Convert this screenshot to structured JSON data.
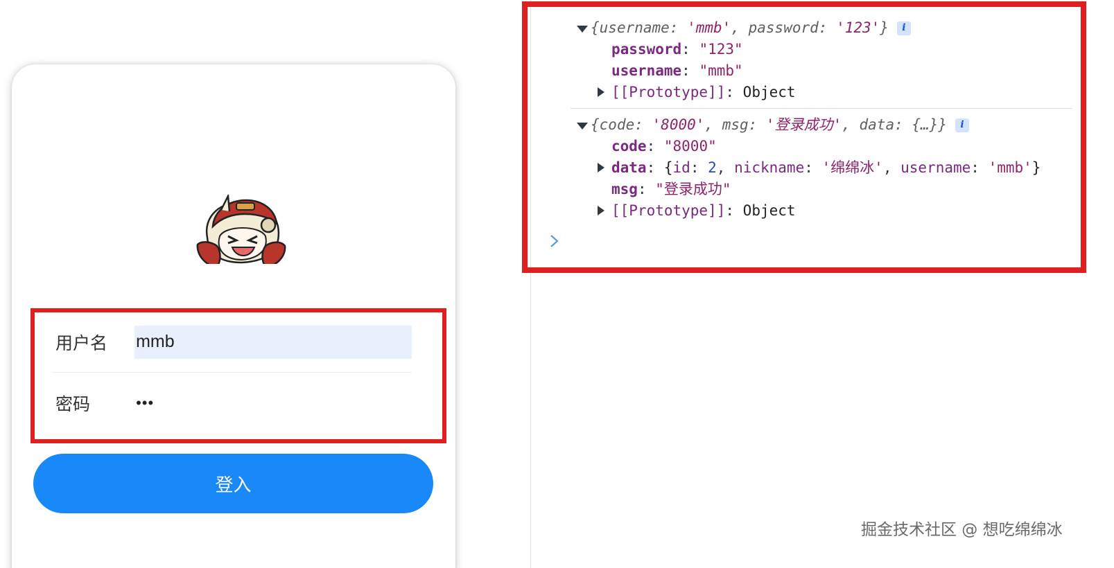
{
  "login": {
    "username_label": "用户名",
    "username_value": "mmb",
    "password_label": "密码",
    "password_masked": "•••",
    "submit_label": "登入"
  },
  "console": {
    "entry1": {
      "preview_open": "{",
      "preview_k1": "username",
      "preview_v1": "'mmb'",
      "preview_k2": "password",
      "preview_v2": "'123'",
      "preview_close": "}",
      "props": [
        {
          "key": "password",
          "value": "\"123\""
        },
        {
          "key": "username",
          "value": "\"mmb\""
        }
      ],
      "proto_label": "[[Prototype]]",
      "proto_value": "Object"
    },
    "entry2": {
      "preview_open": "{",
      "preview_k1": "code",
      "preview_v1": "'8000'",
      "preview_k2": "msg",
      "preview_v2": "'登录成功'",
      "preview_k3": "data",
      "preview_v3": "{…}",
      "preview_close": "}",
      "code_key": "code",
      "code_value": "\"8000\"",
      "data_key": "data",
      "data_open": "{",
      "data_id_key": "id",
      "data_id_value": "2",
      "data_nickname_key": "nickname",
      "data_nickname_value": "'绵绵冰'",
      "data_username_key": "username",
      "data_username_value": "'mmb'",
      "data_close": "}",
      "msg_key": "msg",
      "msg_value": "\"登录成功\"",
      "proto_label": "[[Prototype]]",
      "proto_value": "Object"
    },
    "info_badge": "i"
  },
  "watermark": "掘金技术社区 @ 想吃绵绵冰",
  "colors": {
    "highlight": "#df1f1f",
    "button": "#1989fa",
    "autofill": "#e8f0fe",
    "prop_key": "#7a2980",
    "string": "#8e2468",
    "number": "#1c4dbd"
  },
  "icons": {
    "avatar": "chibi-avatar-image",
    "expand": "triangle-down-icon",
    "collapse": "triangle-right-icon",
    "prompt": "chevron-right-icon",
    "info": "info-icon"
  }
}
